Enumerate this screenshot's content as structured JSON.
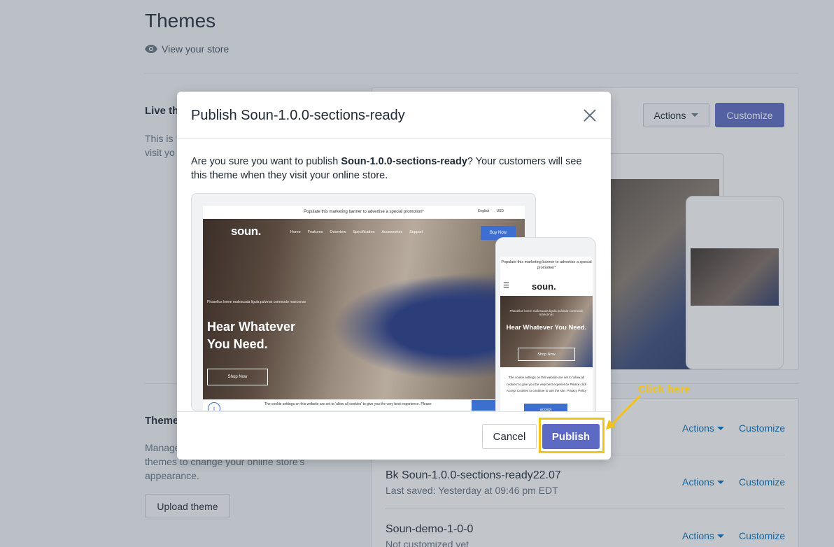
{
  "page": {
    "title": "Themes",
    "view_store": "View your store",
    "live_label": "Live th",
    "live_desc_line1": "This is t",
    "live_desc_line2": "visit yo",
    "actions_label": "Actions",
    "customize_label": "Customize",
    "themes_label": "Theme",
    "themes_desc_line1": "Manage",
    "themes_desc_line2": "themes to change your online store's",
    "themes_desc_line3": "appearance.",
    "upload_label": "Upload theme"
  },
  "library": {
    "rows": [
      {
        "name": "",
        "saved": "",
        "actions": "Actions",
        "customize": "Customize"
      },
      {
        "name": "Bk Soun-1.0.0-sections-ready22.07",
        "saved": "Last saved: Yesterday at 09:46 pm EDT",
        "actions": "Actions",
        "customize": "Customize"
      },
      {
        "name": "Soun-demo-1-0-0",
        "saved": "Not customized yet",
        "actions": "Actions",
        "customize": "Customize"
      }
    ]
  },
  "modal": {
    "title": "Publish Soun-1.0.0-sections-ready",
    "body_prefix": "Are you sure you want to publish ",
    "theme_name": "Soun-1.0.0-sections-ready",
    "body_suffix": "? Your customers will see this theme when they visit your online store.",
    "cancel_label": "Cancel",
    "publish_label": "Publish"
  },
  "preview": {
    "banner": "Populate this marketing banner to advertise a special promotion*",
    "lang": "English",
    "currency": "USD",
    "logo": "soun.",
    "nav": [
      "Home",
      "Features",
      "Overview",
      "Specification",
      "Accessories",
      "Support"
    ],
    "buy_now": "Buy Now",
    "small_text": "Phasellus lorem malesuada ligula pulvinar commodo maecenas",
    "headline_line1": "Hear Whatever",
    "headline_line2": "You Need.",
    "shop_now": "Shop Now",
    "cookie_text": "The cookie settings on this website are set to 'allow all cookies' to give you the very best experience. Please",
    "accept": "accept",
    "phone_banner": "Populate this marketing banner to advertise a special promotion*",
    "phone_headline": "Hear Whatever You Need.",
    "phone_cookie": "The cookie settings on this website are set to 'allow all cookies' to give you the very best experience Please click Accept Cookies to continue to use the site. Privacy Policy"
  },
  "annotation": {
    "click_here": "Click here",
    "color": "#f2c318"
  },
  "colors": {
    "primary": "#5c6ac4",
    "link": "#006fbb",
    "overlay": "rgba(66,79,94,0.32)"
  }
}
